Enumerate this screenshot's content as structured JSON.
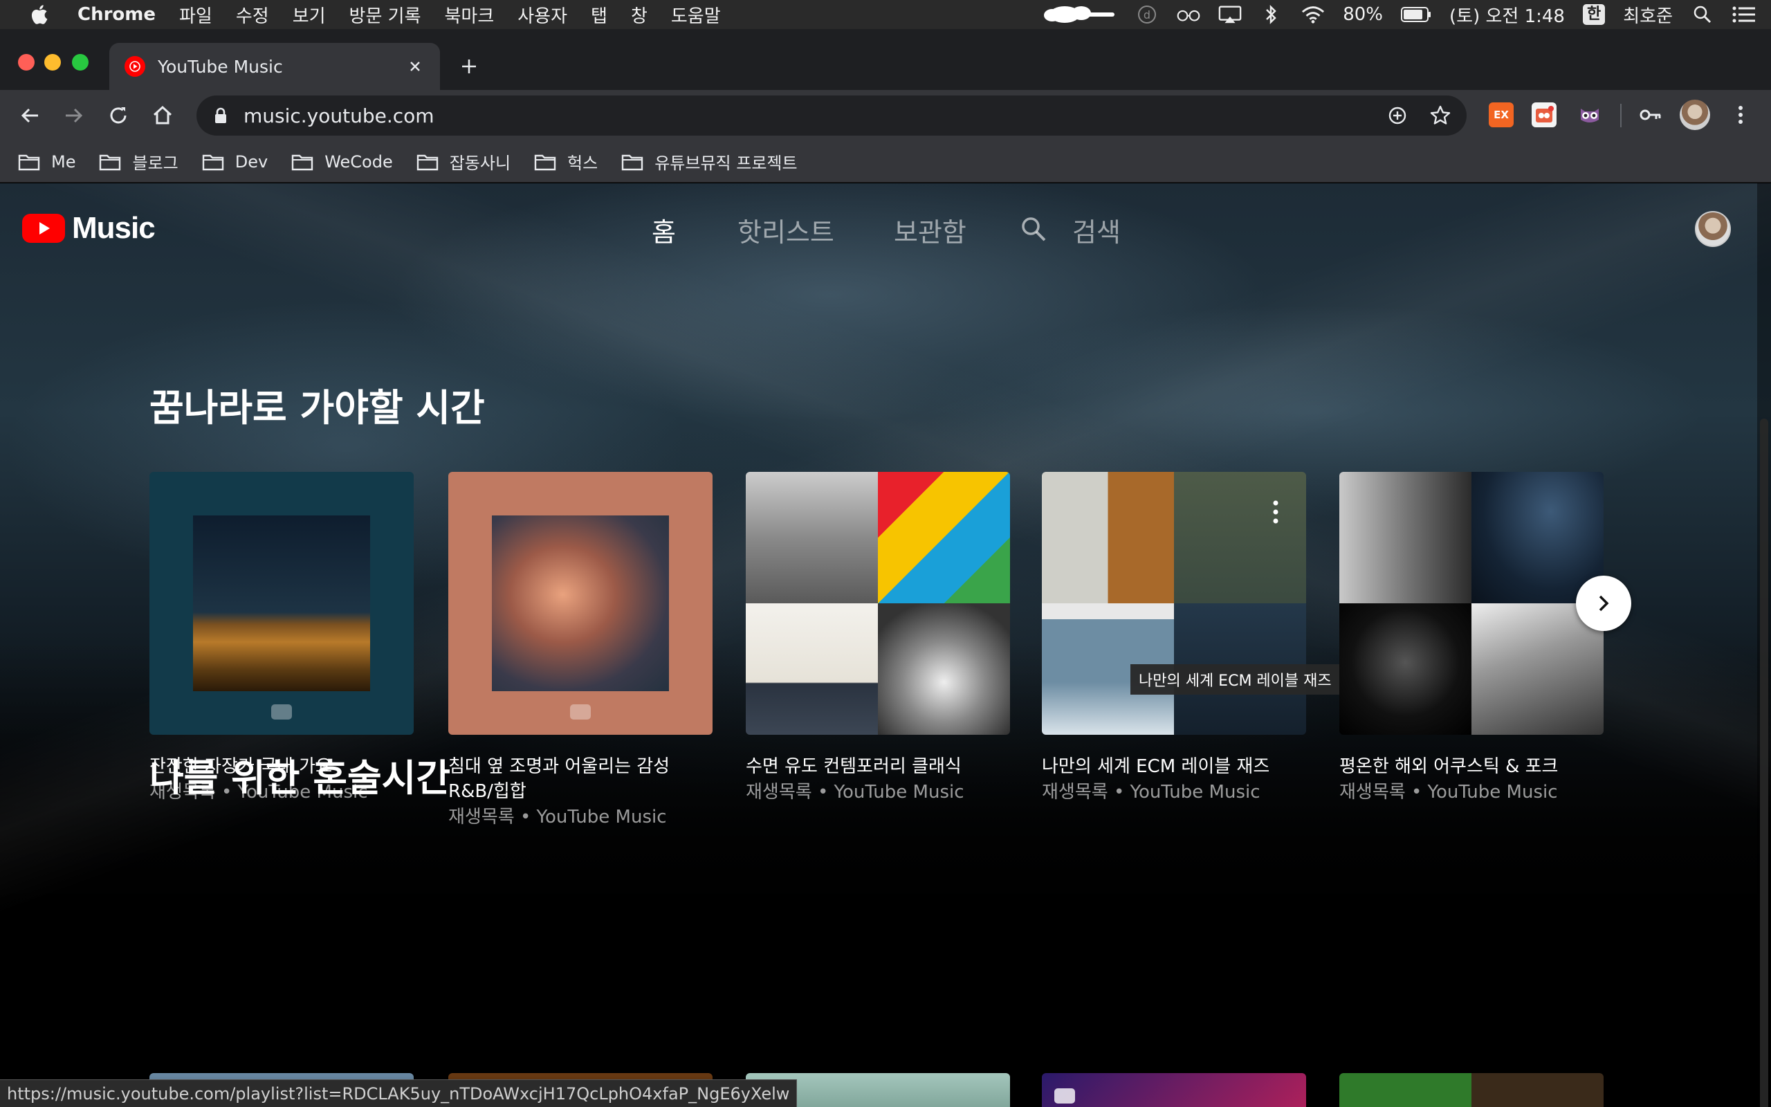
{
  "menubar": {
    "app_name": "Chrome",
    "items": [
      "파일",
      "수정",
      "보기",
      "방문 기록",
      "북마크",
      "사용자",
      "탭",
      "창",
      "도움말"
    ],
    "battery": "80%",
    "clock": "(토) 오전 1:48",
    "ime": "한",
    "user": "최호준"
  },
  "browser": {
    "tab_title": "YouTube Music",
    "url": "music.youtube.com",
    "ext_ex_label": "EX",
    "bookmarks": [
      "Me",
      "블로그",
      "Dev",
      "WeCode",
      "잡동사니",
      "헉스",
      "유튜브뮤직 프로젝트"
    ],
    "status_url": "https://music.youtube.com/playlist?list=RDCLAK5uy_nTDoAWxcjH17QcLphO4xfaP_NgE6yXelw"
  },
  "ytm": {
    "logo_text": "Music",
    "nav": {
      "home": "홈",
      "hotlist": "핫리스트",
      "library": "보관함",
      "search": "검색"
    }
  },
  "section1": {
    "title": "꿈나라로 가야할 시간",
    "cards": [
      {
        "name": "잔잔한 자장가 국내 가요",
        "sub": "재생목록 • YouTube Music"
      },
      {
        "name": "침대 옆 조명과 어울리는 감성 R&B/힙합",
        "sub": "재생목록 • YouTube Music"
      },
      {
        "name": "수면 유도 컨템포러리 클래식",
        "sub": "재생목록 • YouTube Music"
      },
      {
        "name": "나만의 세계 ECM 레이블 재즈",
        "sub": "재생목록 • YouTube Music"
      },
      {
        "name": "평온한 해외 어쿠스틱 & 포크",
        "sub": "재생목록 • YouTube Music"
      }
    ],
    "tooltip": "나만의 세계 ECM 레이블 재즈"
  },
  "section2": {
    "title": "나를 위한 혼술시간"
  },
  "colors": {
    "brand_red": "#ff0000",
    "menubar_bg": "#2a2a2a",
    "toolbar_bg": "#35363a"
  }
}
